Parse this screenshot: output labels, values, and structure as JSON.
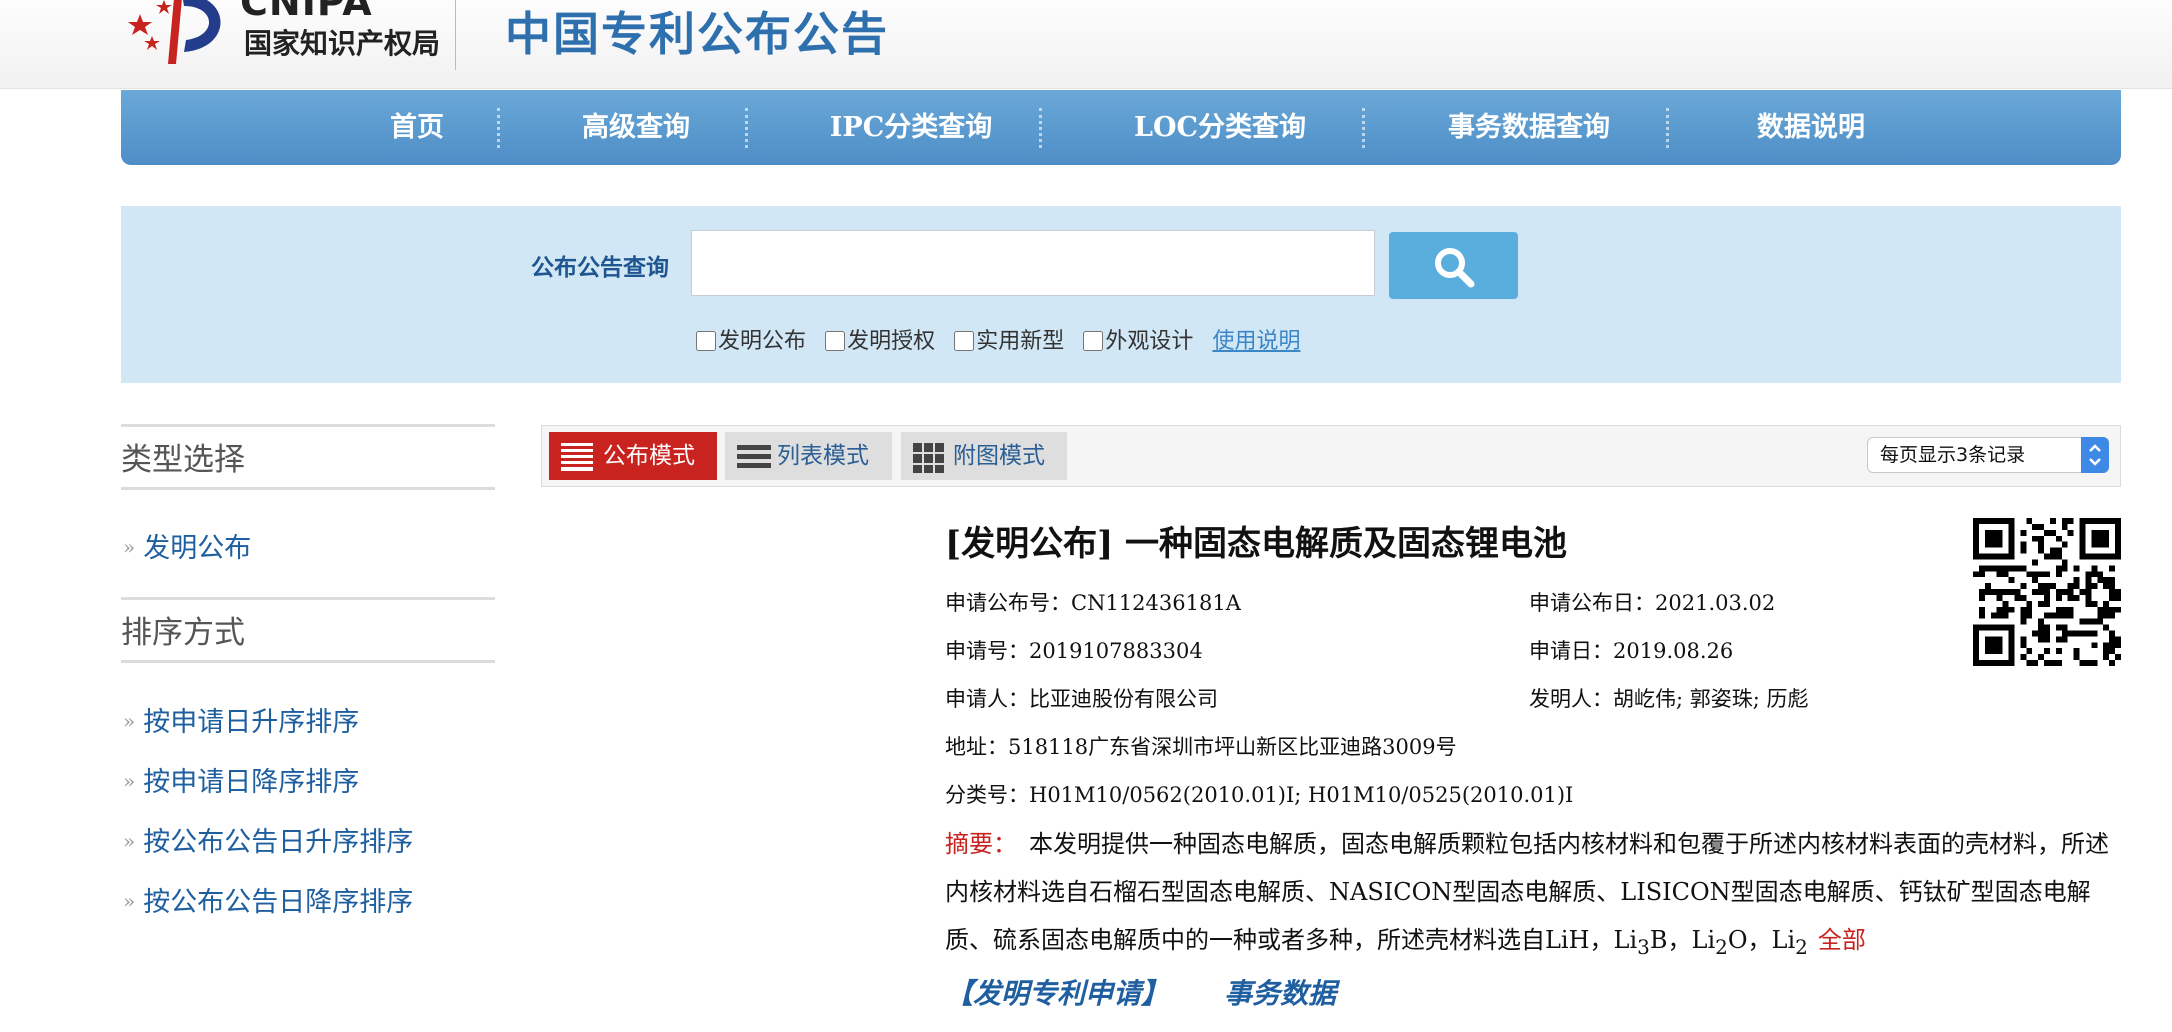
{
  "header": {
    "logo_en": "CNIPA",
    "logo_cn": "国家知识产权局",
    "site_title": "中国专利公布公告"
  },
  "nav": {
    "items": [
      {
        "label": "首页"
      },
      {
        "label": "高级查询"
      },
      {
        "label": "IPC分类查询"
      },
      {
        "label": "LOC分类查询"
      },
      {
        "label": "事务数据查询"
      },
      {
        "label": "数据说明"
      }
    ]
  },
  "search": {
    "label": "公布公告查询",
    "value": "",
    "checkboxes": [
      {
        "label": "发明公布",
        "checked": false
      },
      {
        "label": "发明授权",
        "checked": false
      },
      {
        "label": "实用新型",
        "checked": false
      },
      {
        "label": "外观设计",
        "checked": false
      }
    ],
    "help_link": "使用说明"
  },
  "sidebar": {
    "type_heading": "类型选择",
    "type_items": [
      {
        "label": "发明公布"
      }
    ],
    "sort_heading": "排序方式",
    "sort_items": [
      {
        "label": "按申请日升序排序"
      },
      {
        "label": "按申请日降序排序"
      },
      {
        "label": "按公布公告日升序排序"
      },
      {
        "label": "按公布公告日降序排序"
      }
    ]
  },
  "toolbar": {
    "modes": [
      {
        "label": "公布模式",
        "active": true
      },
      {
        "label": "列表模式",
        "active": false
      },
      {
        "label": "附图模式",
        "active": false
      }
    ],
    "per_page": "每页显示3条记录"
  },
  "record": {
    "title": "[发明公布] 一种固态电解质及固态锂电池",
    "pub_no": {
      "label": "申请公布号：",
      "value": "CN112436181A"
    },
    "pub_date": {
      "label": "申请公布日：",
      "value": "2021.03.02"
    },
    "app_no": {
      "label": "申请号：",
      "value": "2019107883304"
    },
    "app_date": {
      "label": "申请日：",
      "value": "2019.08.26"
    },
    "applicant": {
      "label": "申请人：",
      "value": "比亚迪股份有限公司"
    },
    "inventor": {
      "label": "发明人：",
      "value": "胡屹伟; 郭姿珠; 历彪"
    },
    "address": {
      "label": "地址：",
      "value": "518118广东省深圳市坪山新区比亚迪路3009号"
    },
    "classification": {
      "label": "分类号：",
      "value": "H01M10/0562(2010.01)I; H01M10/0525(2010.01)I"
    },
    "abstract_label": "摘要：",
    "abstract_text": "本发明提供一种固态电解质，固态电解质颗粒包括内核材料和包覆于所述内核材料表面的壳材料，所述内核材料选自石榴石型固态电解质、NASICON型固态电解质、LISICON型固态电解质、钙钛矿型固态电解质、硫系固态电解质中的一种或者多种，所述壳材料选自LiH，Li",
    "abstract_tail": [
      {
        "text": "3",
        "sub": true
      },
      {
        "text": "B，Li",
        "sub": false
      },
      {
        "text": "2",
        "sub": true
      },
      {
        "text": "O，Li",
        "sub": false
      },
      {
        "text": "2",
        "sub": true
      }
    ],
    "more_link": "全部",
    "bottom_links": [
      {
        "label": "【发明专利申请】"
      },
      {
        "label": "事务数据"
      }
    ]
  },
  "colors": {
    "nav_blue": "#5a9ad0",
    "search_bg": "#d2e7f5",
    "active_red": "#c8231f",
    "link_blue": "#1f5f9f",
    "title_blue": "#2e6fae"
  }
}
